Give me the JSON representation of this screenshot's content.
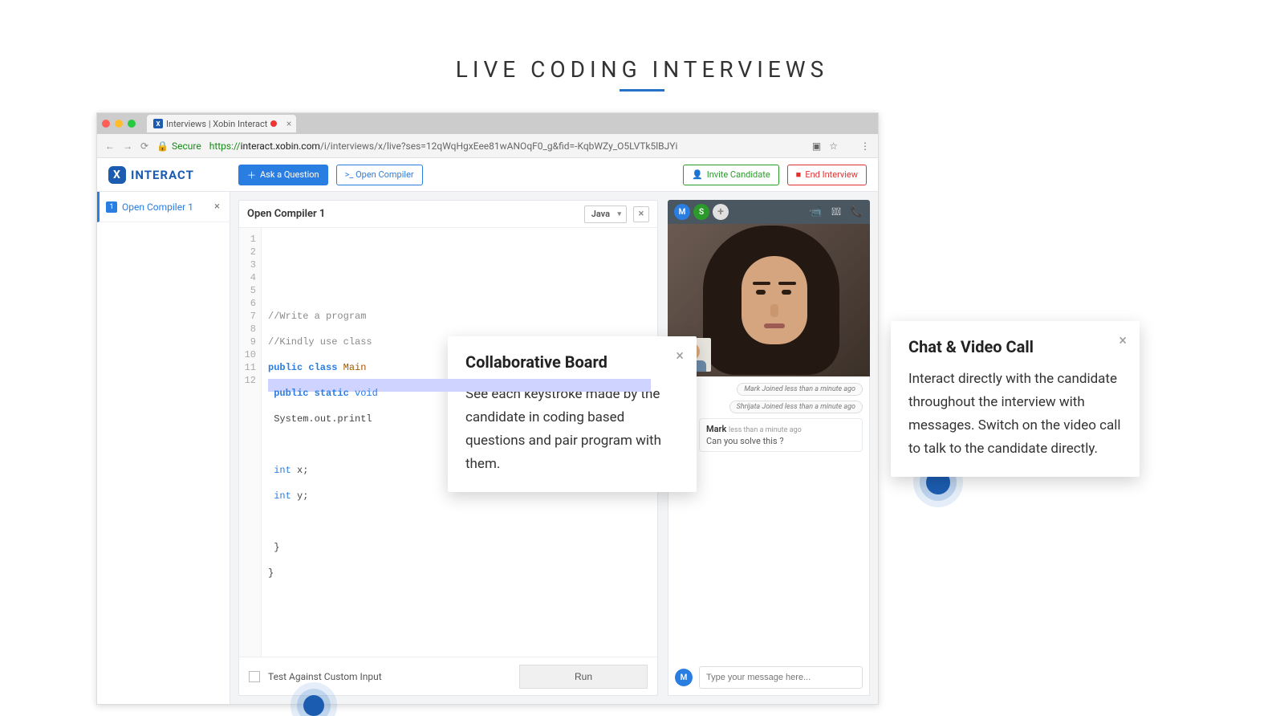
{
  "page": {
    "title": "LIVE CODING INTERVIEWS"
  },
  "browser": {
    "tab_title": "Interviews | Xobin Interact",
    "secure_label": "Secure",
    "url_scheme": "https://",
    "url_host": "interact.xobin.com",
    "url_path": "/i/interviews/x/live?ses=12qWqHgxEee81wANOqF0_g&fid=-KqbWZy_O5LVTk5lBJYi"
  },
  "toolbar": {
    "brand": "INTERACT",
    "ask": "Ask a Question",
    "open_compiler": ">_ Open Compiler",
    "invite": "Invite Candidate",
    "end": "End Interview"
  },
  "sidebar": {
    "items": [
      {
        "badge": "1",
        "label": "Open Compiler 1"
      }
    ]
  },
  "compiler": {
    "title": "Open Compiler 1",
    "language": "Java",
    "lines": [
      "1",
      "2",
      "3",
      "4",
      "5",
      "6",
      "7",
      "8",
      "9",
      "10",
      "11",
      "12"
    ],
    "code": {
      "l2": "//Write a program",
      "l3": "//Kindly use class",
      "l4a": "public class",
      "l4b": "Main",
      "l5a": "public static",
      "l5b": "void",
      "l6": "System.out.printl",
      "l8a": "int",
      "l8b": "x;",
      "l9a": "int",
      "l9b": "y;",
      "l11": "}",
      "l12": "}"
    },
    "test_label": "Test Against Custom Input",
    "run": "Run"
  },
  "video": {
    "avatars": [
      {
        "t": "M",
        "cls": "m"
      },
      {
        "t": "S",
        "cls": "s"
      }
    ],
    "notices": [
      "Mark Joined less than a minute ago",
      "Shrijata Joined less than a minute ago"
    ],
    "msg": {
      "author": "Mark",
      "ts": "less than a minute ago",
      "text": "Can you solve this ?"
    },
    "input_placeholder": "Type your message here..."
  },
  "callouts": {
    "c1": {
      "title": "Collaborative Board",
      "body": "See each keystroke made by the candidate in coding based questions and pair program with them."
    },
    "c2": {
      "title": "Chat & Video Call",
      "body": "Interact directly with the candidate throughout the interview with messages. Switch on the video call to talk to the candidate directly."
    }
  }
}
